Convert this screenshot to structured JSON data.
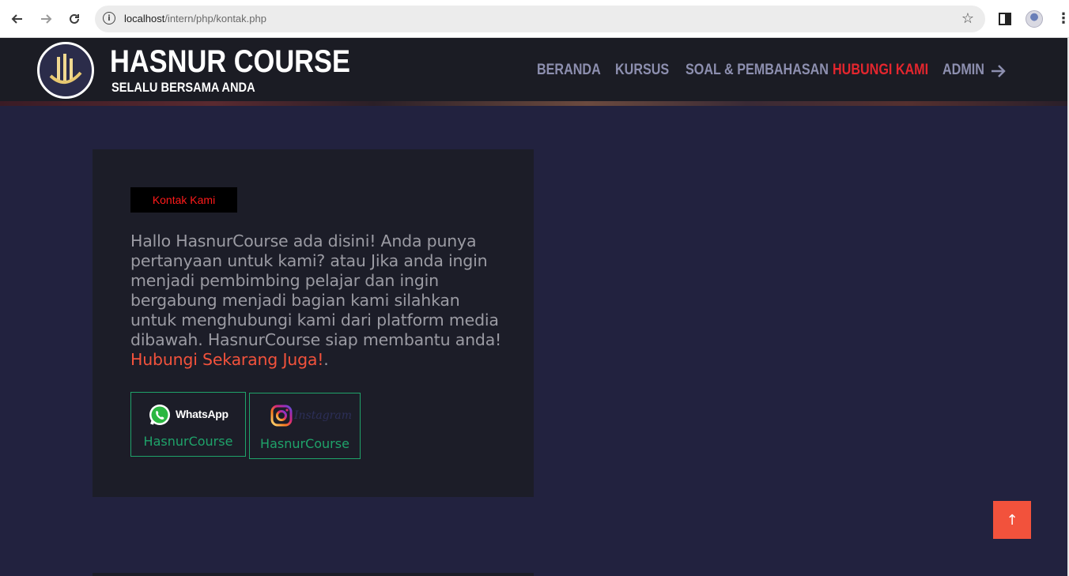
{
  "browser": {
    "url_host": "localhost",
    "url_path": "/intern/php/kontak.php"
  },
  "site": {
    "brand_title": "HASNUR COURSE",
    "brand_subtitle": "SELALU BERSAMA ANDA",
    "nav": [
      {
        "label": "BERANDA",
        "active": false
      },
      {
        "label": "KURSUS",
        "active": false
      },
      {
        "label": "SOAL & PEMBAHASAN",
        "active": false
      },
      {
        "label": "HUBUNGI KAMI",
        "active": true
      },
      {
        "label": "ADMIN",
        "active": false
      }
    ],
    "accent_color": "#e4262e"
  },
  "contact": {
    "badge": "Kontak Kami",
    "body_text": "Hallo HasnurCourse ada disini! Anda punya pertanyaan untuk kami? atau Jika anda ingin menjadi pembimbing pelajar dan ingin bergabung menjadi bagian kami silahkan untuk menghubungi kami dari platform media dibawah. HasnurCourse siap membantu anda! ",
    "highlight": "Hubungi Sekarang Juga!",
    "end_punct": ".",
    "socials": {
      "whatsapp": {
        "label": "WhatsApp",
        "handle": "HasnurCourse",
        "icon": "whatsapp-icon"
      },
      "instagram": {
        "label": "Instagram",
        "handle": "HasnurCourse",
        "icon": "instagram-icon"
      }
    }
  },
  "back_to_top": {
    "icon": "arrow-up-icon",
    "glyph": "↑"
  },
  "colors": {
    "page_bg": "#22223f",
    "card_bg": "#1c1d28",
    "social_green": "#1fa36a",
    "cta_orange": "#f2523c"
  }
}
